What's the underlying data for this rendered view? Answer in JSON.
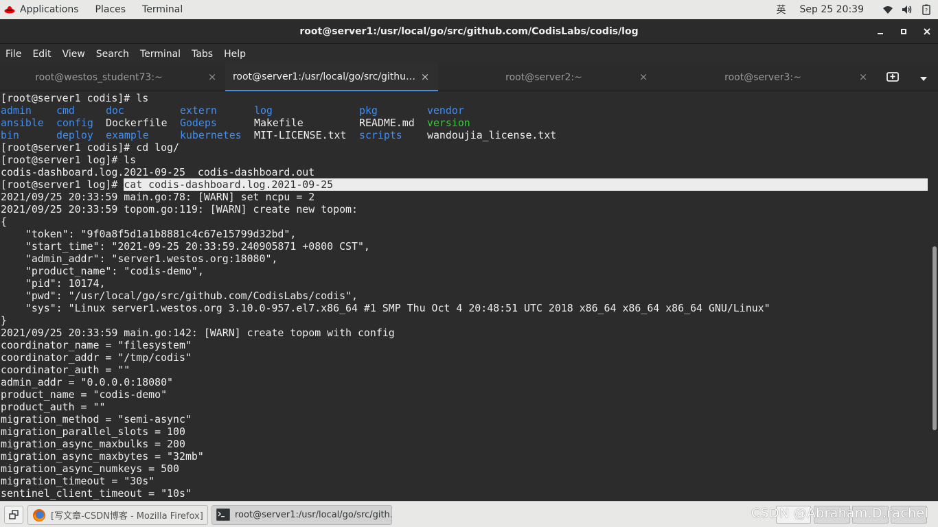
{
  "topbar": {
    "applications": "Applications",
    "places": "Places",
    "terminal": "Terminal",
    "input_method": "英",
    "clock": "Sep 25  20:39",
    "icons": [
      "wifi-icon",
      "volume-icon",
      "battery-icon"
    ]
  },
  "window": {
    "title": "root@server1:/usr/local/go/src/github.com/CodisLabs/codis/log",
    "buttons": [
      "minimize",
      "maximize",
      "close"
    ]
  },
  "menu": [
    "File",
    "Edit",
    "View",
    "Search",
    "Terminal",
    "Tabs",
    "Help"
  ],
  "tabs": [
    {
      "label": "root@westos_student73:~",
      "active": false
    },
    {
      "label": "root@server1:/usr/local/go/src/githu…",
      "active": true
    },
    {
      "label": "root@server2:~",
      "active": false
    },
    {
      "label": "root@server3:~",
      "active": false
    }
  ],
  "terminal": {
    "prompt1": "[root@server1 codis]# ls",
    "ls_rows": [
      [
        {
          "t": "admin",
          "c": "blue"
        },
        {
          "t": "cmd",
          "c": "blue"
        },
        {
          "t": "doc",
          "c": "blue"
        },
        {
          "t": "extern",
          "c": "blue"
        },
        {
          "t": "log",
          "c": "blue"
        },
        {
          "t": "pkg",
          "c": "blue"
        },
        {
          "t": "vendor",
          "c": "blue"
        }
      ],
      [
        {
          "t": "ansible",
          "c": "blue"
        },
        {
          "t": "config",
          "c": "blue"
        },
        {
          "t": "Dockerfile",
          "c": "white"
        },
        {
          "t": "Godeps",
          "c": "blue"
        },
        {
          "t": "Makefile",
          "c": "white"
        },
        {
          "t": "README.md",
          "c": "white"
        },
        {
          "t": "version",
          "c": "green"
        }
      ],
      [
        {
          "t": "bin",
          "c": "blue"
        },
        {
          "t": "deploy",
          "c": "blue"
        },
        {
          "t": "example",
          "c": "blue"
        },
        {
          "t": "kubernetes",
          "c": "blue"
        },
        {
          "t": "MIT-LICENSE.txt",
          "c": "white"
        },
        {
          "t": "scripts",
          "c": "blue"
        },
        {
          "t": "wandoujia_license.txt",
          "c": "white"
        }
      ]
    ],
    "lines_before_hl": [
      "[root@server1 codis]# cd log/",
      "[root@server1 log]# ls",
      "codis-dashboard.log.2021-09-25  codis-dashboard.out"
    ],
    "hl_prompt": "[root@server1 log]# ",
    "hl_cmd": "cat codis-dashboard.log.2021-09-25",
    "lines_after": [
      "2021/09/25 20:33:59 main.go:78: [WARN] set ncpu = 2",
      "2021/09/25 20:33:59 topom.go:119: [WARN] create new topom:",
      "{",
      "    \"token\": \"9f0a8f5d1a1b8881c4c67e15799d32bd\",",
      "    \"start_time\": \"2021-09-25 20:33:59.240905871 +0800 CST\",",
      "    \"admin_addr\": \"server1.westos.org:18080\",",
      "    \"product_name\": \"codis-demo\",",
      "    \"pid\": 10174,",
      "    \"pwd\": \"/usr/local/go/src/github.com/CodisLabs/codis\",",
      "    \"sys\": \"Linux server1.westos.org 3.10.0-957.el7.x86_64 #1 SMP Thu Oct 4 20:48:51 UTC 2018 x86_64 x86_64 x86_64 GNU/Linux\"",
      "}",
      "2021/09/25 20:33:59 main.go:142: [WARN] create topom with config",
      "coordinator_name = \"filesystem\"",
      "coordinator_addr = \"/tmp/codis\"",
      "coordinator_auth = \"\"",
      "admin_addr = \"0.0.0.0:18080\"",
      "product_name = \"codis-demo\"",
      "product_auth = \"\"",
      "migration_method = \"semi-async\"",
      "migration_parallel_slots = 100",
      "migration_async_maxbulks = 200",
      "migration_async_maxbytes = \"32mb\"",
      "migration_async_numkeys = 500",
      "migration_timeout = \"30s\"",
      "sentinel_client_timeout = \"10s\""
    ]
  },
  "taskbar": {
    "tasks": [
      {
        "label": "[写文章-CSDN博客 - Mozilla Firefox]",
        "icon": "firefox-icon",
        "active": false
      },
      {
        "label": "root@server1:/usr/local/go/src/gith...",
        "icon": "terminal-icon",
        "active": true
      }
    ],
    "watermark": "CSDN @Abraham.D.rachel"
  }
}
